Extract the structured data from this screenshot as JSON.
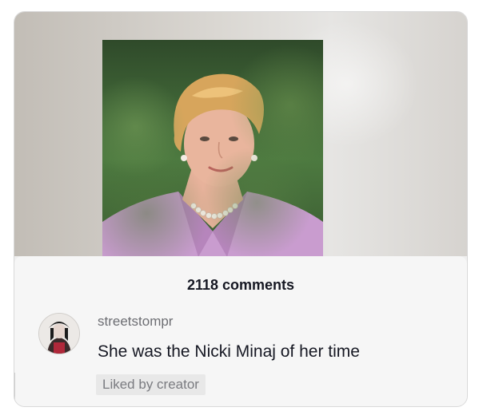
{
  "video": {
    "image_description_icon": "portrait-photo"
  },
  "comments": {
    "count_label": "2118 comments",
    "items": [
      {
        "username": "streetstompr",
        "text": "She was the Nicki Minaj of her time",
        "badge": "Liked by creator",
        "avatar_icon": "avatar-icon"
      }
    ]
  }
}
